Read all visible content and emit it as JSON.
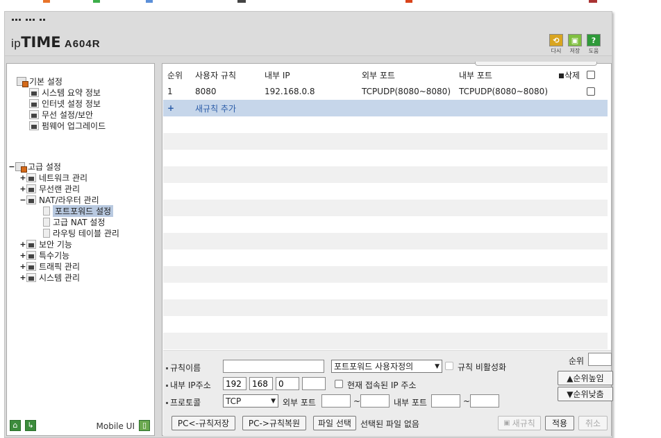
{
  "header": {
    "brand_ip": "ip",
    "brand_time": "TIME",
    "brand_model": "A604R",
    "buttons": [
      {
        "label": "다시",
        "icon": "refresh-icon",
        "color": "#d9a520",
        "glyph": "⟲"
      },
      {
        "label": "저장",
        "icon": "save-icon",
        "color": "#7fbf3f",
        "glyph": "▣"
      },
      {
        "label": "도움",
        "icon": "help-icon",
        "color": "#2f9a3a",
        "glyph": "?"
      }
    ]
  },
  "sidebar": {
    "basic": {
      "label": "기본 설정",
      "items": [
        "시스템 요약 정보",
        "인터넷 설정 정보",
        "무선 설정/보안",
        "펌웨어 업그레이드"
      ]
    },
    "advanced": {
      "label": "고급 설정",
      "items": [
        {
          "label": "네트워크 관리",
          "pm": "+"
        },
        {
          "label": "무선랜 관리",
          "pm": "+"
        },
        {
          "label": "NAT/라우터 관리",
          "pm": "−"
        },
        {
          "label": "보안 기능",
          "pm": "+"
        },
        {
          "label": "특수기능",
          "pm": "+"
        },
        {
          "label": "트래픽 관리",
          "pm": "+"
        },
        {
          "label": "시스템 관리",
          "pm": "+"
        }
      ],
      "nat_children": [
        "포트포워드 설정",
        "고급 NAT 설정",
        "라우팅 테이블 관리"
      ],
      "advanced_pm": "−"
    },
    "footer": {
      "mobile_ui": "Mobile UI"
    }
  },
  "table": {
    "headers": [
      "순위",
      "사용자 규칙",
      "내부 IP",
      "외부 포트",
      "내부 포트",
      "삭제"
    ],
    "rows": [
      {
        "rank": "1",
        "rule": "8080",
        "ip": "192.168.0.8",
        "ext": "TCPUDP(8080~8080)",
        "int": "TCPUDP(8080~8080)"
      }
    ],
    "add_row": {
      "plus": "+",
      "label": "새규칙 추가"
    }
  },
  "form": {
    "rule_name_label": "규칙이름",
    "rule_name_value": "",
    "preset_select": "포트포워드 사용자정의",
    "disable_label": "규칙 비활성화",
    "internal_ip_label": "내부 IP주소",
    "ip_octets": [
      "192",
      "168",
      "0",
      ""
    ],
    "current_ip_label": "현재 접속된 IP 주소",
    "protocol_label": "프로토콜",
    "protocol_value": "TCP",
    "external_port_label": "외부 포트",
    "internal_port_label": "내부 포트",
    "tilde": "~",
    "rank_label": "순위",
    "rank_up": "순위높임",
    "rank_down": "순위낮춤",
    "buttons": {
      "pc_save": "PC<-규칙저장",
      "pc_restore": "PC->규칙복원",
      "file_select": "파일 선택",
      "no_file": "선택된 파일 없음",
      "new_rule": "새규칙",
      "apply": "적용",
      "cancel": "취소"
    }
  }
}
